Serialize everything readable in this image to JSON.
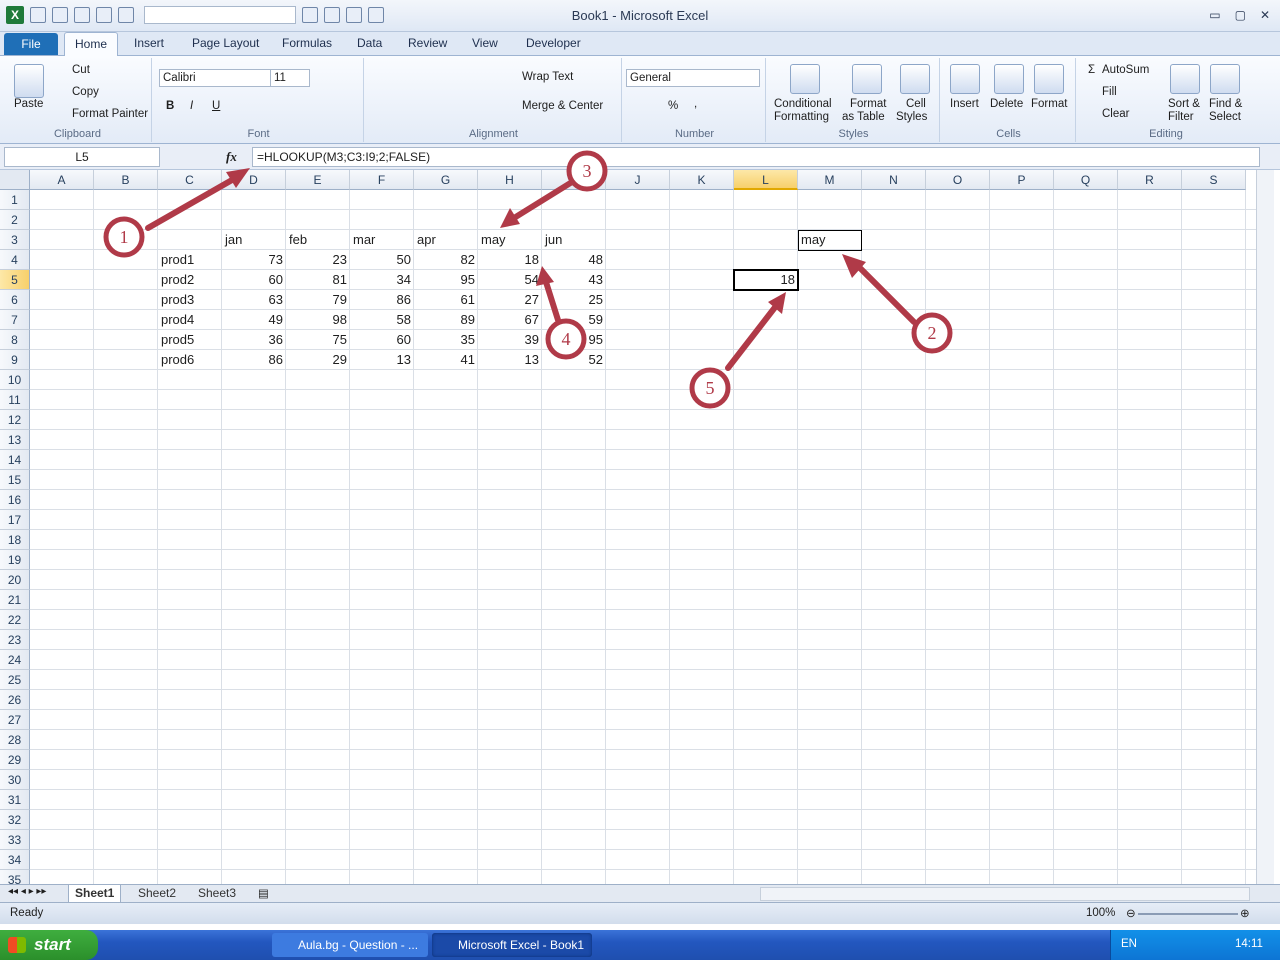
{
  "window": {
    "title": "Book1 - Microsoft Excel",
    "min": "▭",
    "max": "▢",
    "close": "✕"
  },
  "tabs": [
    "File",
    "Home",
    "Insert",
    "Page Layout",
    "Formulas",
    "Data",
    "Review",
    "View",
    "Developer"
  ],
  "ribbon": {
    "clipboard": {
      "paste": "Paste",
      "cut": "Cut",
      "copy": "Copy",
      "format_painter": "Format Painter",
      "label": "Clipboard"
    },
    "font": {
      "name": "Calibri",
      "size": "11",
      "bold": "B",
      "italic": "I",
      "underline": "U",
      "label": "Font"
    },
    "alignment": {
      "wrap": "Wrap Text",
      "merge": "Merge & Center",
      "label": "Alignment"
    },
    "number": {
      "format": "General",
      "percent": "%",
      "comma": ",",
      "label": "Number"
    },
    "styles": {
      "conditional": "Conditional",
      "conditional2": "Formatting",
      "format_table": "Format",
      "format_table2": "as Table",
      "cell_styles": "Cell",
      "cell_styles2": "Styles",
      "label": "Styles"
    },
    "cells": {
      "insert": "Insert",
      "delete": "Delete",
      "format": "Format",
      "label": "Cells"
    },
    "editing": {
      "autosum": "AutoSum",
      "fill": "Fill",
      "clear": "Clear",
      "sort": "Sort &",
      "sort2": "Filter",
      "find": "Find &",
      "find2": "Select",
      "label": "Editing"
    }
  },
  "formula_bar": {
    "name_box": "L5",
    "fx": "fx",
    "formula": "=HLOOKUP(M3;C3:I9;2;FALSE)"
  },
  "columns": [
    "A",
    "B",
    "C",
    "D",
    "E",
    "F",
    "G",
    "H",
    "I",
    "J",
    "K",
    "L",
    "M",
    "N",
    "O",
    "P",
    "Q",
    "R",
    "S"
  ],
  "rows": [
    "1",
    "2",
    "3",
    "4",
    "5",
    "6",
    "7",
    "8",
    "9",
    "10",
    "11",
    "12",
    "13",
    "14",
    "15",
    "16",
    "17",
    "18",
    "19",
    "20",
    "21",
    "22",
    "23",
    "24",
    "25",
    "26",
    "27",
    "28",
    "29",
    "30",
    "31",
    "32",
    "33",
    "34",
    "35"
  ],
  "sheet": {
    "headers": [
      "jan",
      "feb",
      "mar",
      "apr",
      "may",
      "jun"
    ],
    "products": [
      "prod1",
      "prod2",
      "prod3",
      "prod4",
      "prod5",
      "prod6"
    ],
    "values": [
      [
        "73",
        "23",
        "50",
        "82",
        "18",
        "48"
      ],
      [
        "60",
        "81",
        "34",
        "95",
        "54",
        "43"
      ],
      [
        "63",
        "79",
        "86",
        "61",
        "27",
        "25"
      ],
      [
        "49",
        "98",
        "58",
        "89",
        "67",
        "59"
      ],
      [
        "36",
        "75",
        "60",
        "35",
        "39",
        "95"
      ],
      [
        "86",
        "29",
        "13",
        "41",
        "13",
        "52"
      ]
    ],
    "lookup_key": "may",
    "result": "18"
  },
  "annotations": [
    "1",
    "2",
    "3",
    "4",
    "5"
  ],
  "sheet_tabs": [
    "Sheet1",
    "Sheet2",
    "Sheet3"
  ],
  "status": {
    "ready": "Ready",
    "zoom": "100%"
  },
  "taskbar": {
    "start": "start",
    "windows": [
      "Aula.bg - Question - ...",
      "Microsoft Excel - Book1"
    ],
    "lang": "EN",
    "clock": "14:11"
  },
  "colors": {
    "annotation": "#b03a48",
    "selected_header": "#f7d06b",
    "file_tab": "#1f6fb7"
  }
}
